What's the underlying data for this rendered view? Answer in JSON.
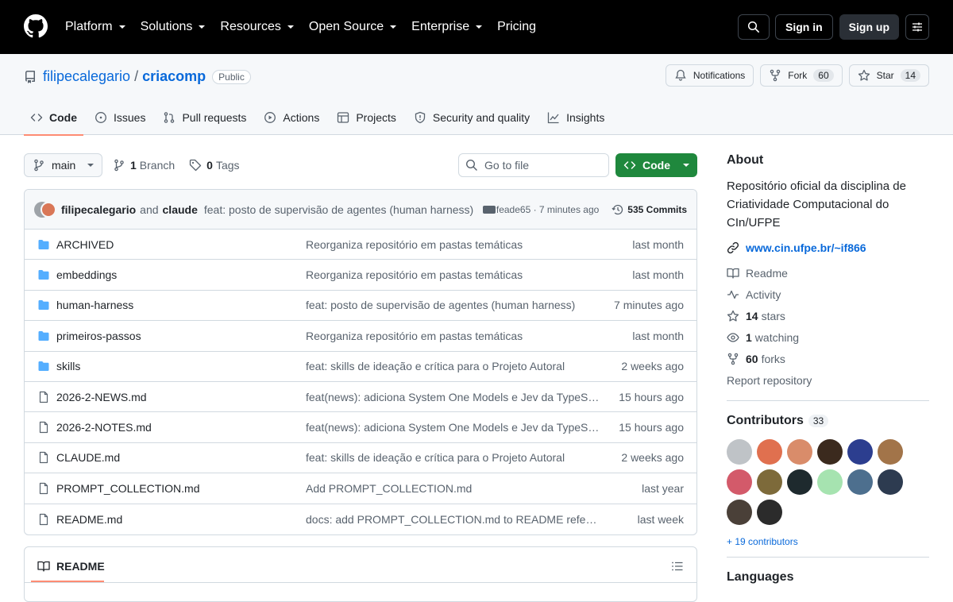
{
  "topnav": {
    "items": [
      {
        "label": "Platform",
        "dropdown": true
      },
      {
        "label": "Solutions",
        "dropdown": true
      },
      {
        "label": "Resources",
        "dropdown": true
      },
      {
        "label": "Open Source",
        "dropdown": true
      },
      {
        "label": "Enterprise",
        "dropdown": true
      },
      {
        "label": "Pricing",
        "dropdown": false
      }
    ],
    "signin": "Sign in",
    "signup": "Sign up"
  },
  "repo": {
    "owner": "filipecalegario",
    "separator": "/",
    "name": "criacomp",
    "visibility": "Public",
    "notifications": "Notifications",
    "fork_label": "Fork",
    "fork_count": "60",
    "star_label": "Star",
    "star_count": "14"
  },
  "tabs": [
    {
      "label": "Code",
      "icon": "code-icon"
    },
    {
      "label": "Issues",
      "icon": "issue-icon"
    },
    {
      "label": "Pull requests",
      "icon": "pull-request-icon"
    },
    {
      "label": "Actions",
      "icon": "play-icon"
    },
    {
      "label": "Projects",
      "icon": "table-icon"
    },
    {
      "label": "Security and quality",
      "icon": "shield-icon"
    },
    {
      "label": "Insights",
      "icon": "graph-icon"
    }
  ],
  "toolbar": {
    "branch": "main",
    "branch_count": "1",
    "branch_label": "Branch",
    "tag_count": "0",
    "tag_label": "Tags",
    "gofile_placeholder": "Go to file",
    "code_label": "Code"
  },
  "commit": {
    "author1": "filipecalegario",
    "and": "and",
    "author2": "claude",
    "message": "feat: posto de supervisão de agentes (human harness)",
    "sha_time": "feade65 · 7 minutes ago",
    "commits": "535 Commits"
  },
  "files": [
    {
      "name": "ARCHIVED",
      "type": "dir",
      "message": "Reorganiza repositório em pastas temáticas",
      "date": "last month"
    },
    {
      "name": "embeddings",
      "type": "dir",
      "message": "Reorganiza repositório em pastas temáticas",
      "date": "last month"
    },
    {
      "name": "human-harness",
      "type": "dir",
      "message": "feat: posto de supervisão de agentes (human harness)",
      "date": "7 minutes ago"
    },
    {
      "name": "primeiros-passos",
      "type": "dir",
      "message": "Reorganiza repositório em pastas temáticas",
      "date": "last month"
    },
    {
      "name": "skills",
      "type": "dir",
      "message": "feat: skills de ideação e crítica para o Projeto Autoral",
      "date": "2 weeks ago"
    },
    {
      "name": "2026-2-NEWS.md",
      "type": "file",
      "message": "feat(news): adiciona System One Models e Jev da TypeSaf…",
      "date": "15 hours ago"
    },
    {
      "name": "2026-2-NOTES.md",
      "type": "file",
      "message": "feat(news): adiciona System One Models e Jev da TypeSaf…",
      "date": "15 hours ago"
    },
    {
      "name": "CLAUDE.md",
      "type": "file",
      "message": "feat: skills de ideação e crítica para o Projeto Autoral",
      "date": "2 weeks ago"
    },
    {
      "name": "PROMPT_COLLECTION.md",
      "type": "file",
      "message": "Add PROMPT_COLLECTION.md",
      "date": "last year"
    },
    {
      "name": "README.md",
      "type": "file",
      "message": "docs: add PROMPT_COLLECTION.md to README referen…",
      "date": "last week"
    }
  ],
  "readme": {
    "tab": "README"
  },
  "about": {
    "title": "About",
    "description": "Repositório oficial da disciplina de Criatividade Computacional do CIn/UFPE",
    "website": "www.cin.ufpe.br/~if866",
    "readme": "Readme",
    "activity": "Activity",
    "stars_count": "14",
    "stars_label": "stars",
    "watching_count": "1",
    "watching_label": "watching",
    "forks_count": "60",
    "forks_label": "forks",
    "report": "Report repository"
  },
  "contributors": {
    "title": "Contributors",
    "count": "33",
    "avatar_colors": [
      "#bfc3c7",
      "#e0704f",
      "#d98c6a",
      "#3b2a1e",
      "#2c3e8f",
      "#a27449",
      "#d35a6a",
      "#7d6a3a",
      "#1e2a2e",
      "#a6e3b0",
      "#4d6f8e",
      "#2d3b50",
      "#4a4038",
      "#2b2b2b"
    ],
    "more": "+ 19 contributors"
  },
  "languages": {
    "title": "Languages"
  },
  "colors": {
    "accent": "#0969da",
    "green": "#1f883d",
    "tab_underline": "#fd8c73",
    "folder": "#54aeff"
  }
}
